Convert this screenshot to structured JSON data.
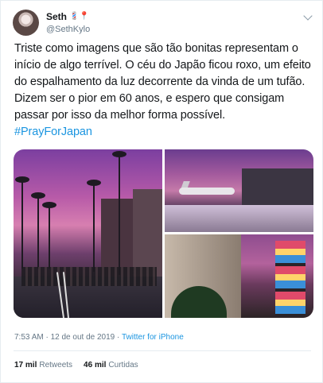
{
  "author": {
    "name": "Seth",
    "handle": "@SethKylo",
    "name_emojis": "💈📍",
    "avatar_icon": "profile-avatar"
  },
  "tweet": {
    "text": "Triste como imagens que são tão bonitas representam o início de algo terrível. O céu do Japão ficou roxo, um efeito do espalhamento da luz decorrente da vinda de um tufão. Dizem ser o pior em 60 anos, e espero que consigam passar por isso da melhor forma possível.",
    "hashtag": "#PrayForJapan"
  },
  "media": {
    "images": [
      {
        "name": "purple-sky-street-palms"
      },
      {
        "name": "purple-sky-airport-plane"
      },
      {
        "name": "purple-sky-city-signs"
      }
    ]
  },
  "meta": {
    "time": "7:53 AM",
    "separator": " · ",
    "date": "12 de out de 2019",
    "source": "Twitter for iPhone"
  },
  "stats": {
    "retweets_count": "17 mil",
    "retweets_label": "Retweets",
    "likes_count": "46 mil",
    "likes_label": "Curtidas"
  },
  "colors": {
    "link": "#1b95e0",
    "secondary_text": "#657786",
    "primary_text": "#14171a"
  }
}
